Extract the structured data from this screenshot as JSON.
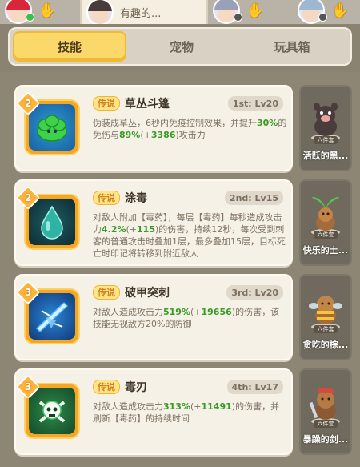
{
  "topbar": {
    "active_name": "有趣的..."
  },
  "tabs": [
    {
      "label": "技能"
    },
    {
      "label": "宠物"
    },
    {
      "label": "玩具箱"
    }
  ],
  "skills": [
    {
      "level": "2",
      "tag": "传说",
      "name": "草丛斗篷",
      "slot": "1st: Lv20",
      "desc_parts": [
        "伪装成草丛，6秒内免疫控制效果，并提升",
        "30%",
        "的免伤与",
        "89%",
        "(+",
        "3386",
        ")攻击力"
      ],
      "icon": "bush-cloak-icon",
      "accent": "#3ed14a"
    },
    {
      "level": "2",
      "tag": "传说",
      "name": "涂毒",
      "slot": "2nd: Lv15",
      "desc_parts": [
        "对敌人附加【毒药】，每层【毒药】每秒造成攻击力",
        "4.2%",
        "(+",
        "115",
        ")的伤害，持续12秒，每次受到刺客的普通攻击时叠加1层，最多叠加15层，目标死亡时印记将转移到附近敌人"
      ],
      "icon": "poison-drop-icon",
      "accent": "#2fb3a3"
    },
    {
      "level": "3",
      "tag": "传说",
      "name": "破甲突刺",
      "slot": "3rd: Lv20",
      "desc_parts": [
        "对敌人造成攻击力",
        "519%",
        "(+",
        "19656",
        ")的伤害，该技能无视敌方20%的防御"
      ],
      "icon": "armor-pierce-icon",
      "accent": "#4fb8ff"
    },
    {
      "level": "3",
      "tag": "传说",
      "name": "毒刃",
      "slot": "4th: Lv17",
      "desc_parts": [
        "对敌人造成攻击力",
        "313%",
        "(+",
        "11491",
        ")的伤害，并刷新【毒药】的持续时间"
      ],
      "icon": "poison-skull-icon",
      "accent": "#49c16a"
    }
  ],
  "pets": [
    {
      "name": "活跃的黑...",
      "chip": "六件套",
      "icon": "black-pig-pet-icon"
    },
    {
      "name": "快乐的土...",
      "chip": "六件套",
      "icon": "sprout-pet-icon"
    },
    {
      "name": "贪吃的棕...",
      "chip": "六件套",
      "icon": "bee-bear-pet-icon"
    },
    {
      "name": "暴躁的剑...",
      "chip": "六件套",
      "icon": "sword-pet-icon"
    }
  ],
  "colors": {
    "tab_active": "#fbd86a",
    "tag_bg": "#ffe48a",
    "highlight_green": "#3a9a25",
    "badge_orange": "#ffb33a"
  }
}
